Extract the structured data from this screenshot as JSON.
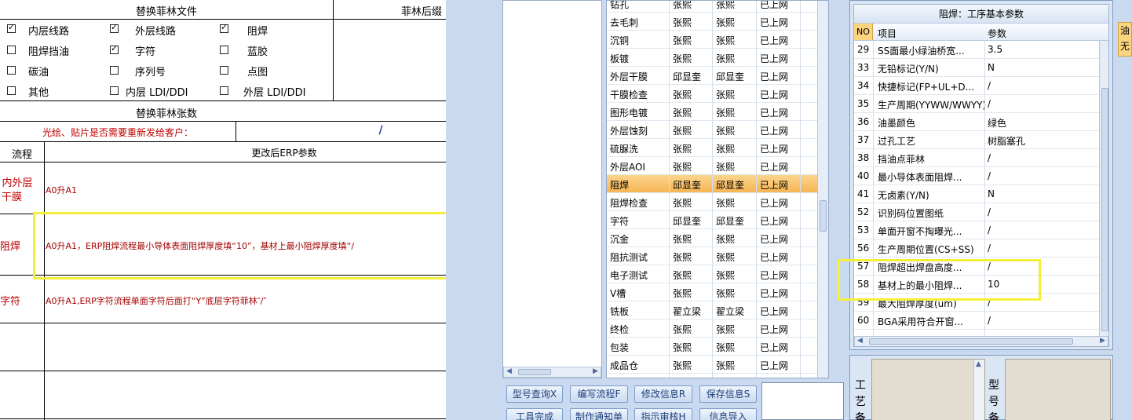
{
  "doc": {
    "title_replace_film": "替换菲林文件",
    "title_after": "菲林后缀",
    "checkboxes": [
      {
        "label": "内层线路",
        "checked": true
      },
      {
        "label": "外层线路",
        "checked": true
      },
      {
        "label": "阻焊",
        "checked": true
      },
      {
        "label": "阻焊挡油",
        "checked": false
      },
      {
        "label": "字符",
        "checked": true
      },
      {
        "label": "蓝胶",
        "checked": false
      },
      {
        "label": "碳油",
        "checked": false
      },
      {
        "label": "序列号",
        "checked": false
      },
      {
        "label": "点图",
        "checked": false
      },
      {
        "label": "其他",
        "checked": false
      },
      {
        "label": "内层 LDI/DDI",
        "checked": false
      },
      {
        "label": "外层 LDI/DDI",
        "checked": false
      }
    ],
    "replace_count_label": "替换菲林张数",
    "resend_question": "光绘、贴片是否需要重新发给客户：",
    "resend_value": "/",
    "col_process": "流程",
    "col_erp": "更改后ERP参数",
    "rows": [
      {
        "process_line1": "内外层",
        "process_line2": "干膜",
        "erp": "A0升A1"
      },
      {
        "process_line1": "阻焊",
        "process_line2": "",
        "erp": "A0升A1，ERP阻焊流程最小导体表面阻焊厚度填“10”，基材上最小阻焊厚度填“/"
      },
      {
        "process_line1": "字符",
        "process_line2": "",
        "erp": "A0升A1,ERP字符流程单面字符后面打“Y”底层字符菲林″/″"
      }
    ]
  },
  "flow_grid": {
    "rows": [
      {
        "name": "钻孔",
        "a": "张熙",
        "b": "张熙",
        "status": "已上网"
      },
      {
        "name": "去毛刺",
        "a": "张熙",
        "b": "张熙",
        "status": "已上网"
      },
      {
        "name": "沉铜",
        "a": "张熙",
        "b": "张熙",
        "status": "已上网"
      },
      {
        "name": "板镀",
        "a": "张熙",
        "b": "张熙",
        "status": "已上网"
      },
      {
        "name": "外层干膜",
        "a": "邱显奎",
        "b": "邱显奎",
        "status": "已上网"
      },
      {
        "name": "干膜检查",
        "a": "张熙",
        "b": "张熙",
        "status": "已上网"
      },
      {
        "name": "图形电镀",
        "a": "张熙",
        "b": "张熙",
        "status": "已上网"
      },
      {
        "name": "外层蚀刻",
        "a": "张熙",
        "b": "张熙",
        "status": "已上网"
      },
      {
        "name": "硫脲洗",
        "a": "张熙",
        "b": "张熙",
        "status": "已上网"
      },
      {
        "name": "外层AOI",
        "a": "张熙",
        "b": "张熙",
        "status": "已上网"
      },
      {
        "name": "阻焊",
        "a": "邱显奎",
        "b": "邱显奎",
        "status": "已上网",
        "selected": true
      },
      {
        "name": "阻焊检查",
        "a": "张熙",
        "b": "张熙",
        "status": "已上网"
      },
      {
        "name": "字符",
        "a": "邱显奎",
        "b": "邱显奎",
        "status": "已上网"
      },
      {
        "name": "沉金",
        "a": "张熙",
        "b": "张熙",
        "status": "已上网"
      },
      {
        "name": "阻抗测试",
        "a": "张熙",
        "b": "张熙",
        "status": "已上网"
      },
      {
        "name": "电子测试",
        "a": "张熙",
        "b": "张熙",
        "status": "已上网"
      },
      {
        "name": "V槽",
        "a": "张熙",
        "b": "张熙",
        "status": "已上网"
      },
      {
        "name": "铣板",
        "a": "翟立梁",
        "b": "翟立梁",
        "status": "已上网"
      },
      {
        "name": "终检",
        "a": "张熙",
        "b": "张熙",
        "status": "已上网"
      },
      {
        "name": "包装",
        "a": "张熙",
        "b": "张熙",
        "status": "已上网"
      },
      {
        "name": "成品仓",
        "a": "张熙",
        "b": "张熙",
        "status": "已上网"
      }
    ]
  },
  "buttons": {
    "query": "型号查询X",
    "edit_flow": "编写流程F",
    "modify": "修改信息R",
    "save": "保存信息S",
    "tool_done": "工具完成",
    "notice": "制作通知单",
    "audit": "指示审核H",
    "import": "信息导入"
  },
  "param_panel": {
    "title": "阻焊：工序基本参数",
    "col_no": "NO",
    "col_item": "项目",
    "col_param": "参数",
    "rows": [
      {
        "no": "29",
        "item": "SS面最小绿油桥宽...",
        "param": "3.5"
      },
      {
        "no": "33",
        "item": "无铅标记(Y/N)",
        "param": "N"
      },
      {
        "no": "34",
        "item": "快捷标记(FP+UL+D...",
        "param": "/"
      },
      {
        "no": "35",
        "item": "生产周期(YYWW/WWYY)",
        "param": "/"
      },
      {
        "no": "36",
        "item": "油墨颜色",
        "param": "绿色"
      },
      {
        "no": "37",
        "item": "过孔工艺",
        "param": "树脂塞孔"
      },
      {
        "no": "38",
        "item": "挡油点菲林",
        "param": "/"
      },
      {
        "no": "40",
        "item": "最小导体表面阻焊...",
        "param": "/"
      },
      {
        "no": "41",
        "item": "无卤素(Y/N)",
        "param": "N"
      },
      {
        "no": "52",
        "item": "识别码位置图纸",
        "param": "/"
      },
      {
        "no": "53",
        "item": "单面开窗不掏曝光...",
        "param": "/"
      },
      {
        "no": "56",
        "item": "生产周期位置(CS+SS)",
        "param": "/"
      },
      {
        "no": "57",
        "item": "阻焊超出焊盘高度...",
        "param": "/"
      },
      {
        "no": "58",
        "item": "基材上的最小阻焊...",
        "param": "10"
      },
      {
        "no": "59",
        "item": "最大阻焊厚度(um)",
        "param": "/"
      },
      {
        "no": "60",
        "item": "BGA采用符合开窗...",
        "param": "/"
      }
    ]
  },
  "bottom": {
    "label_left": "工艺备",
    "label_right": "型号备"
  },
  "edge": {
    "line1": "油",
    "line2": "无"
  }
}
